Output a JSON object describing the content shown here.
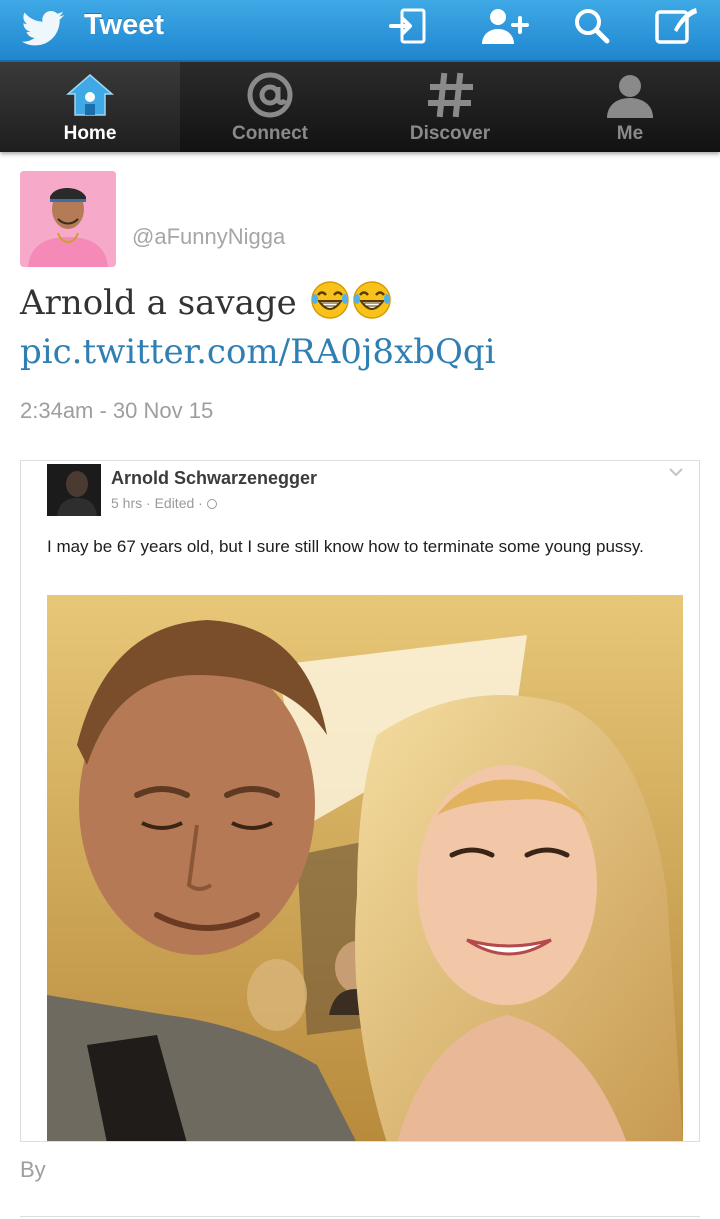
{
  "app_bar": {
    "title": "Tweet",
    "logo_icon": "twitter-bird-icon",
    "actions": [
      "sign-in-icon",
      "add-user-icon",
      "search-icon",
      "compose-icon"
    ]
  },
  "tabs": [
    {
      "label": "Home",
      "icon": "home-icon",
      "active": true
    },
    {
      "label": "Connect",
      "icon": "at-sign-icon",
      "active": false
    },
    {
      "label": "Discover",
      "icon": "hashtag-icon",
      "active": false
    },
    {
      "label": "Me",
      "icon": "person-icon",
      "active": false
    }
  ],
  "tweet": {
    "handle": "@aFunnyNigga",
    "text": "Arnold a savage",
    "emoji": [
      "face-with-tears-of-joy",
      "face-with-tears-of-joy"
    ],
    "link": "pic.twitter.com/RA0j8xbQqi",
    "timestamp": "2:34am - 30 Nov 15",
    "byline": "By"
  },
  "media": {
    "post_author": "Arnold Schwarzenegger",
    "post_meta": "5 hrs · Edited · ",
    "post_text": "I may be 67 years old, but I sure still know how to terminate some young pussy."
  },
  "colors": {
    "app_bar": "#1f86cf",
    "tab_bar": "#1a1a1a",
    "link": "#2f7fb3",
    "muted_text": "#9e9e9e"
  }
}
